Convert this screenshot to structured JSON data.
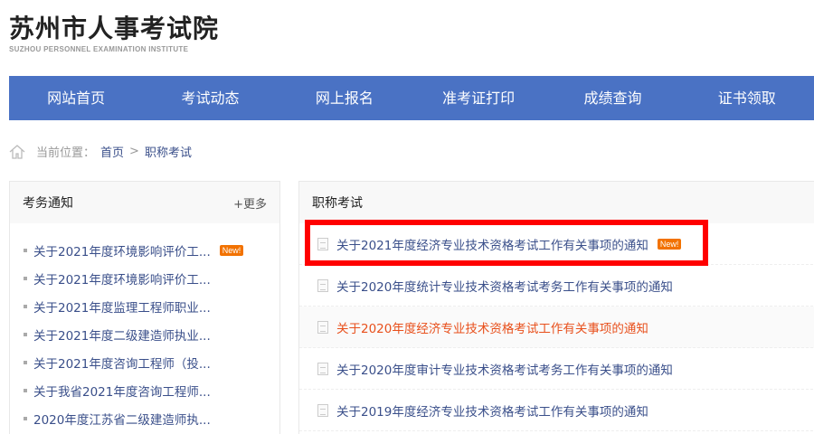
{
  "header": {
    "title": "苏州市人事考试院",
    "subtitle": "SUZHOU PERSONNEL EXAMINATION INSTITUTE"
  },
  "nav": [
    "网站首页",
    "考试动态",
    "网上报名",
    "准考证打印",
    "成绩查询",
    "证书领取"
  ],
  "breadcrumb": {
    "label": "当前位置：",
    "home": "首页",
    "sep": ">",
    "current": "职称考试"
  },
  "left": {
    "title": "考务通知",
    "more": "+更多",
    "badge": "New!",
    "items": [
      "关于2021年度环境影响评价工...",
      "关于2021年度环境影响评价工...",
      "关于2021年度监理工程师职业...",
      "关于2021年度二级建造师执业...",
      "关于2021年度咨询工程师（投...",
      "关于我省2021年度咨询工程师...",
      "2020年度江苏省二级建造师执..."
    ]
  },
  "right": {
    "title": "职称考试",
    "badge": "New!",
    "items": [
      "关于2021年度经济专业技术资格考试工作有关事项的通知",
      "关于2020年度统计专业技术资格考试考务工作有关事项的通知",
      "关于2020年度经济专业技术资格考试工作有关事项的通知",
      "关于2020年度审计专业技术资格考试考务工作有关事项的通知",
      "关于2019年度经济专业技术资格考试工作有关事项的通知"
    ]
  }
}
